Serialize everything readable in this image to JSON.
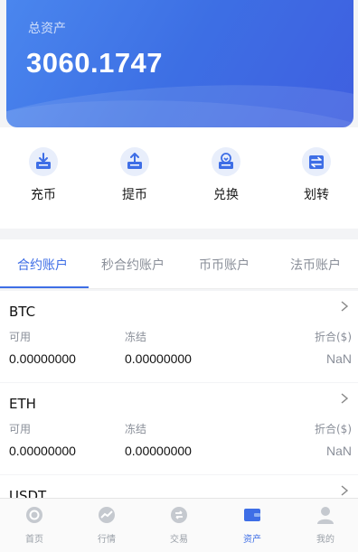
{
  "asset": {
    "label": "总资产",
    "value": "3060.1747"
  },
  "actions": [
    {
      "label": "充币",
      "icon": "deposit-icon"
    },
    {
      "label": "提币",
      "icon": "withdraw-icon"
    },
    {
      "label": "兑换",
      "icon": "exchange-icon"
    },
    {
      "label": "划转",
      "icon": "transfer-icon"
    }
  ],
  "tabs": [
    {
      "label": "合约账户",
      "active": true
    },
    {
      "label": "秒合约账户",
      "active": false
    },
    {
      "label": "币币账户",
      "active": false
    },
    {
      "label": "法币账户",
      "active": false
    }
  ],
  "columns": {
    "available": "可用",
    "frozen": "冻结",
    "converted": "折合($)"
  },
  "accounts": [
    {
      "name": "BTC",
      "available": "0.00000000",
      "frozen": "0.00000000",
      "converted": "NaN"
    },
    {
      "name": "ETH",
      "available": "0.00000000",
      "frozen": "0.00000000",
      "converted": "NaN"
    },
    {
      "name": "USDT"
    }
  ],
  "bottom_nav": [
    {
      "label": "首页",
      "icon": "home-icon",
      "active": false
    },
    {
      "label": "行情",
      "icon": "market-icon",
      "active": false
    },
    {
      "label": "交易",
      "icon": "trade-icon",
      "active": false
    },
    {
      "label": "资产",
      "icon": "wallet-icon",
      "active": true
    },
    {
      "label": "我的",
      "icon": "profile-icon",
      "active": false
    }
  ],
  "colors": {
    "accent": "#3e6ee6",
    "card_start": "#4a86ee",
    "card_end": "#3f5fe0",
    "muted": "#8a8f99"
  }
}
